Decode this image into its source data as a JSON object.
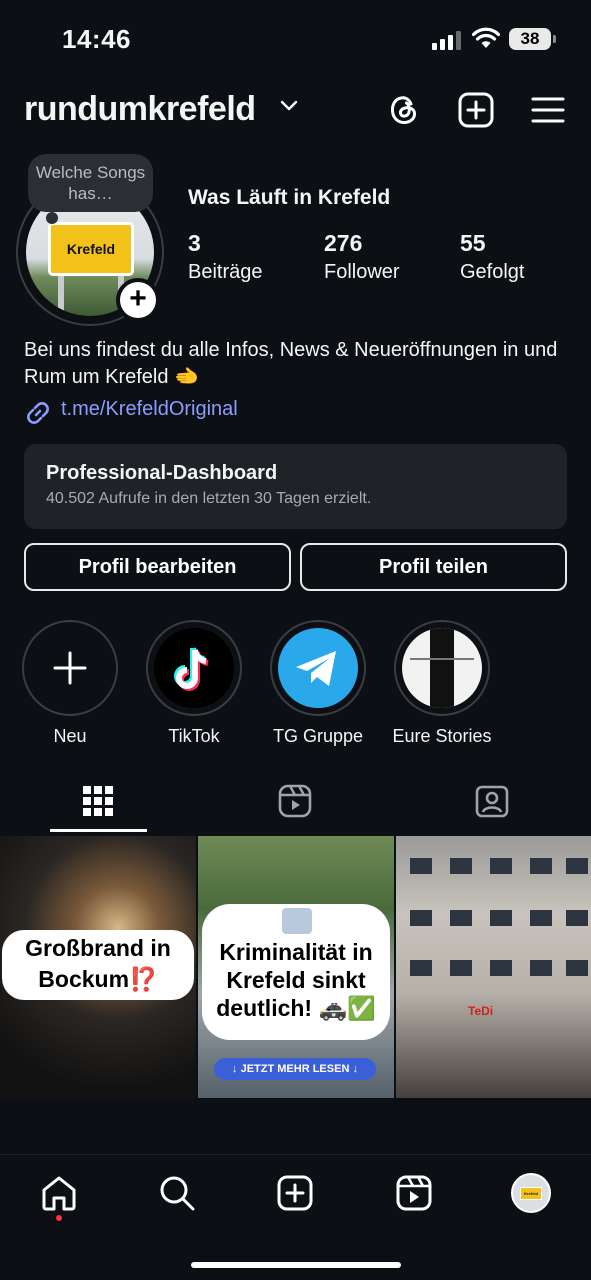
{
  "status_bar": {
    "time": "14:46",
    "battery": "38"
  },
  "header": {
    "username": "rundumkrefeld"
  },
  "profile": {
    "note": "Welche Songs has…",
    "avatar_sign_text": "Krefeld",
    "display_name": "Was Läuft in Krefeld",
    "stats": [
      {
        "value": "3",
        "label": "Beiträge"
      },
      {
        "value": "276",
        "label": "Follower"
      },
      {
        "value": "55",
        "label": "Gefolgt"
      }
    ],
    "bio": "Bei uns findest du alle Infos, News & Neueröffnungen in und Rum um Krefeld 🫲",
    "link": "t.me/KrefeldOriginal"
  },
  "dashboard": {
    "title": "Professional-Dashboard",
    "subtitle": "40.502 Aufrufe in den letzten 30 Tagen erzielt."
  },
  "actions": {
    "edit_profile": "Profil bearbeiten",
    "share_profile": "Profil teilen"
  },
  "highlights": [
    {
      "label": "Neu",
      "icon": "plus-icon"
    },
    {
      "label": "TikTok",
      "icon": "tiktok-logo"
    },
    {
      "label": "TG Gruppe",
      "icon": "telegram-logo"
    },
    {
      "label": "Eure Stories",
      "icon": "story-thumbnail"
    }
  ],
  "tabs": [
    {
      "icon": "grid-icon",
      "active": true
    },
    {
      "icon": "reels-icon",
      "active": false
    },
    {
      "icon": "tagged-icon",
      "active": false
    }
  ],
  "posts": [
    {
      "caption": "Großbrand in Bockum⁉️"
    },
    {
      "caption": "Kriminalität in Krefeld sinkt deutlich! 🚓✅",
      "button": "↓ JETZT MEHR LESEN ↓"
    },
    {
      "caption": "",
      "sign": "TeDi"
    }
  ],
  "bottom_nav": [
    {
      "icon": "home-icon",
      "active": true
    },
    {
      "icon": "search-icon"
    },
    {
      "icon": "create-icon"
    },
    {
      "icon": "reels-icon"
    },
    {
      "icon": "profile-avatar"
    }
  ],
  "colors": {
    "background": "#0c1014",
    "link": "#8c9dff",
    "notification_dot": "#ff3040",
    "telegram": "#29a9eb"
  }
}
